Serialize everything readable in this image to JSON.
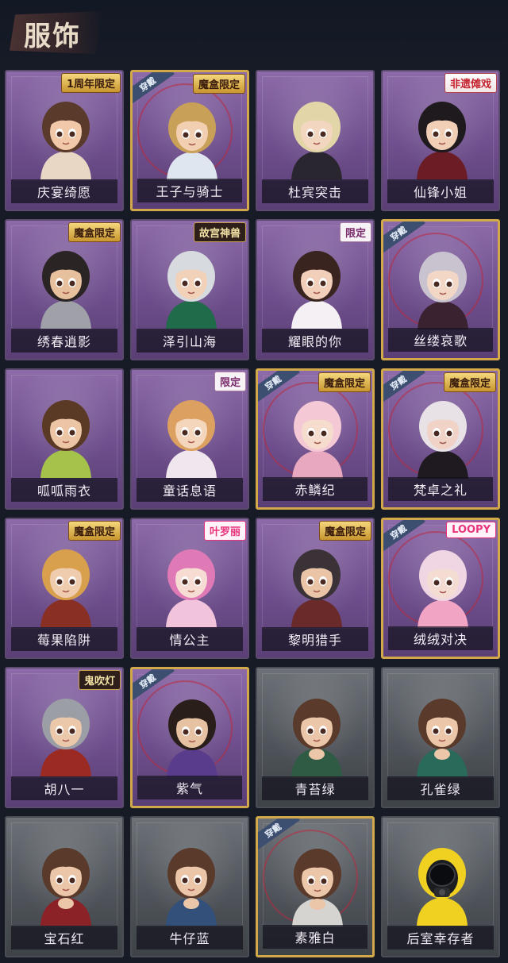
{
  "header": {
    "title": "服饰"
  },
  "skins": [
    {
      "name": "庆宴绮愿",
      "badge": "1周年限定",
      "badge_style": "gold",
      "equipped": false,
      "tone": "purple",
      "hair": "#5a3a2a",
      "outfit": "#e9d7c5",
      "skin": "#f1c9a8"
    },
    {
      "name": "王子与骑士",
      "badge": "魔盒限定",
      "badge_style": "gold",
      "equipped": true,
      "tone": "purple",
      "hair": "#c9a058",
      "outfit": "#e0e6f0",
      "skin": "#f1cfb0"
    },
    {
      "name": "杜宾突击",
      "badge": "",
      "badge_style": "",
      "equipped": false,
      "tone": "purple",
      "hair": "#e2d6a8",
      "outfit": "#2a2630",
      "skin": "#f3d6bf"
    },
    {
      "name": "仙锋小姐",
      "badge": "非遗傩戏",
      "badge_style": "red",
      "equipped": false,
      "tone": "purple",
      "hair": "#1e1a1e",
      "outfit": "#6b1c24",
      "skin": "#f1cfb6"
    },
    {
      "name": "绣春逍影",
      "badge": "魔盒限定",
      "badge_style": "gold",
      "equipped": false,
      "tone": "purple",
      "hair": "#2a2424",
      "outfit": "#9fa0a8",
      "skin": "#e7c09e"
    },
    {
      "name": "泽引山海",
      "badge": "故宫神兽",
      "badge_style": "dark",
      "equipped": false,
      "tone": "purple",
      "hair": "#d7dadf",
      "outfit": "#1f6b4a",
      "skin": "#f1d2b8"
    },
    {
      "name": "耀眼的你",
      "badge": "限定",
      "badge_style": "white",
      "equipped": false,
      "tone": "purple",
      "hair": "#3a2420",
      "outfit": "#f4f0f4",
      "skin": "#f1cfbb"
    },
    {
      "name": "丝缕哀歌",
      "badge": "",
      "badge_style": "",
      "equipped": true,
      "tone": "purple",
      "hair": "#c9c3d0",
      "outfit": "#3b2230",
      "skin": "#f2d6c6"
    },
    {
      "name": "呱呱雨衣",
      "badge": "",
      "badge_style": "",
      "equipped": false,
      "tone": "purple",
      "hair": "#5a3a24",
      "outfit": "#a5c24a",
      "skin": "#ecc6a4"
    },
    {
      "name": "童话息语",
      "badge": "限定",
      "badge_style": "white",
      "equipped": false,
      "tone": "purple",
      "hair": "#dca060",
      "outfit": "#f0e6ee",
      "skin": "#f4d6bc"
    },
    {
      "name": "赤鳞纪",
      "badge": "魔盒限定",
      "badge_style": "gold",
      "equipped": true,
      "tone": "purple",
      "hair": "#f4c8d4",
      "outfit": "#e8a8c0",
      "skin": "#f6dccc"
    },
    {
      "name": "梵卓之礼",
      "badge": "魔盒限定",
      "badge_style": "gold",
      "equipped": true,
      "tone": "purple",
      "hair": "#e8e2e6",
      "outfit": "#1e1a20",
      "skin": "#f0d2c6"
    },
    {
      "name": "莓果陷阱",
      "badge": "魔盒限定",
      "badge_style": "gold",
      "equipped": false,
      "tone": "purple",
      "hair": "#d8a04c",
      "outfit": "#8a2f24",
      "skin": "#f0ccae"
    },
    {
      "name": "情公主",
      "badge": "叶罗丽",
      "badge_style": "pink",
      "equipped": false,
      "tone": "purple",
      "hair": "#e07ab6",
      "outfit": "#f2c4dc",
      "skin": "#f6dcd2"
    },
    {
      "name": "黎明猎手",
      "badge": "魔盒限定",
      "badge_style": "gold",
      "equipped": false,
      "tone": "purple",
      "hair": "#3a3236",
      "outfit": "#6a2a2a",
      "skin": "#eac4a6"
    },
    {
      "name": "绒绒对决",
      "badge": "LOOPY",
      "badge_style": "pink",
      "equipped": true,
      "tone": "purple",
      "hair": "#f0d6e2",
      "outfit": "#f2a4c4",
      "skin": "#f4dcd2"
    },
    {
      "name": "胡八一",
      "badge": "鬼吹灯",
      "badge_style": "dark",
      "equipped": false,
      "tone": "purple",
      "hair": "#9c9ea6",
      "outfit": "#9a2a22",
      "skin": "#ecc8aa"
    },
    {
      "name": "紫气",
      "badge": "",
      "badge_style": "",
      "equipped": true,
      "tone": "purple",
      "hair": "#2a1e1a",
      "outfit": "#5a3c8c",
      "skin": "#e7c2a2"
    },
    {
      "name": "青苔绿",
      "badge": "",
      "badge_style": "",
      "equipped": false,
      "tone": "grey",
      "hair": "#5a3a2a",
      "outfit": "#2f5a44",
      "skin": "#ecc6a8"
    },
    {
      "name": "孔雀绿",
      "badge": "",
      "badge_style": "",
      "equipped": false,
      "tone": "grey",
      "hair": "#5a3a2a",
      "outfit": "#2a6a5a",
      "skin": "#ecc6a8"
    },
    {
      "name": "宝石红",
      "badge": "",
      "badge_style": "",
      "equipped": false,
      "tone": "grey",
      "hair": "#5a3a2a",
      "outfit": "#8a2228",
      "skin": "#ecc6a8"
    },
    {
      "name": "牛仔蓝",
      "badge": "",
      "badge_style": "",
      "equipped": false,
      "tone": "grey",
      "hair": "#5a3a2a",
      "outfit": "#33507a",
      "skin": "#ecc6a8"
    },
    {
      "name": "素雅白",
      "badge": "",
      "badge_style": "",
      "equipped": true,
      "tone": "grey",
      "hair": "#5a3a2a",
      "outfit": "#d6d4d0",
      "skin": "#ecc6a8"
    },
    {
      "name": "后室幸存者",
      "badge": "",
      "badge_style": "",
      "equipped": false,
      "tone": "grey",
      "hair": "#f0d020",
      "outfit": "#f0d020",
      "skin": "#1a1c20"
    }
  ],
  "wear_label": "穿戴"
}
